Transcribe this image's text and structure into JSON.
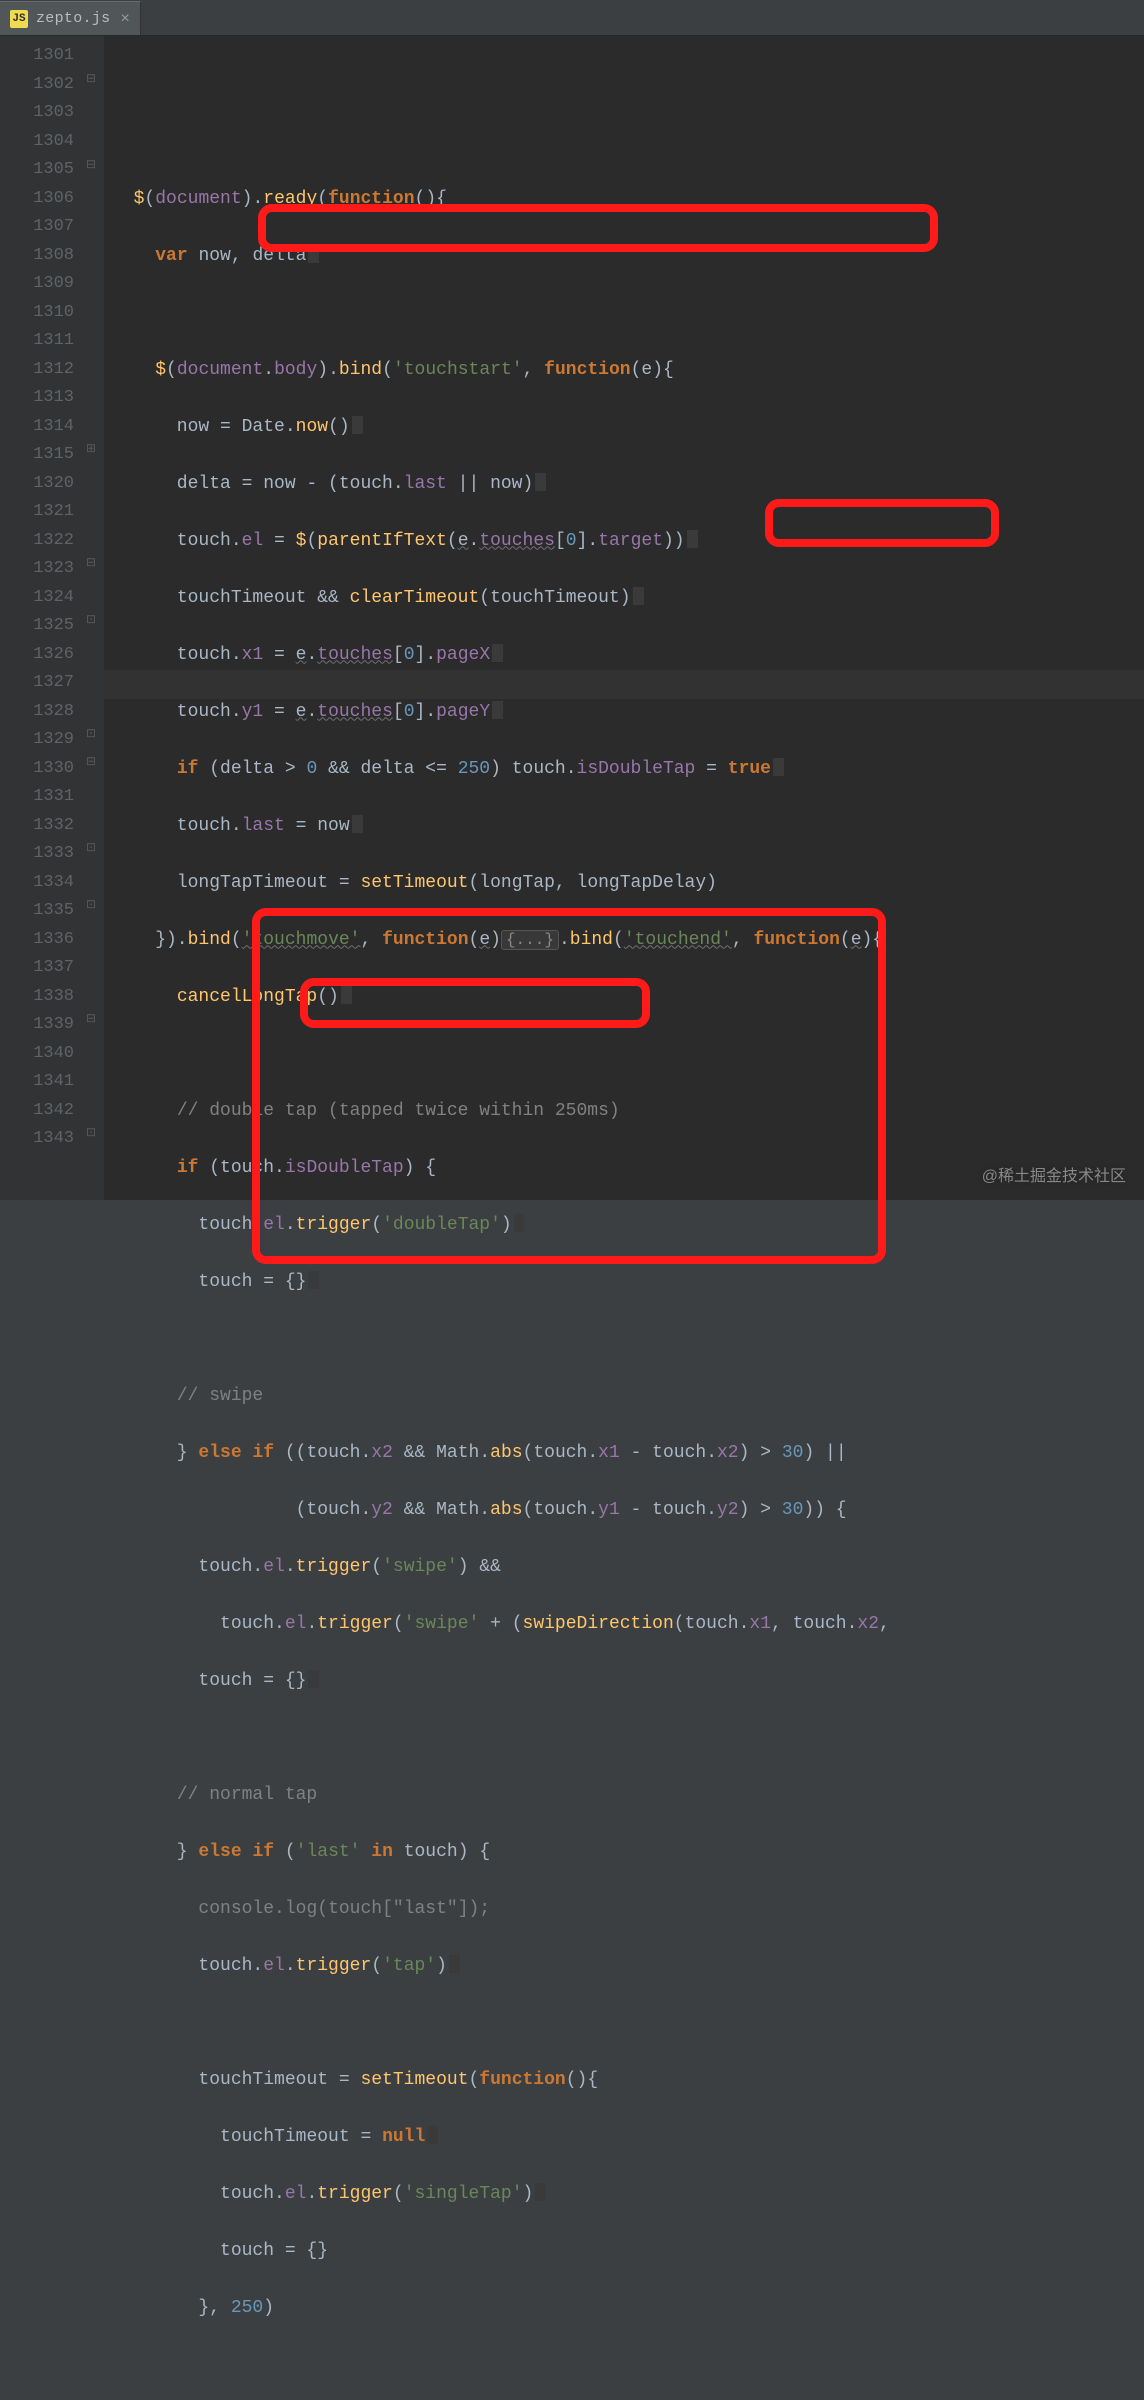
{
  "tab": {
    "filename": "zepto.js",
    "badge": "JS"
  },
  "line_numbers": [
    1301,
    1302,
    1303,
    1304,
    1305,
    1306,
    1307,
    1308,
    1309,
    1310,
    1311,
    1312,
    1313,
    1314,
    1315,
    1320,
    1321,
    1322,
    1323,
    1324,
    1325,
    1326,
    1327,
    1328,
    1329,
    1330,
    1331,
    1332,
    1333,
    1334,
    1335,
    1336,
    1337,
    1338,
    1339,
    1340,
    1341,
    1342,
    1343
  ],
  "watermark": "@稀土掘金技术社区",
  "strings": {
    "touchstart": "'touchstart'",
    "touchmove": "'touchmove'",
    "touchend": "'touchend'",
    "doubleTap": "'doubleTap'",
    "swipe": "'swipe'",
    "swipe2": "'swipe'",
    "last": "'last'",
    "lastIdx": "\"last\"",
    "tap": "'tap'",
    "singleTap": "'singleTap'"
  },
  "nums": {
    "zero": "0",
    "n250": "250",
    "n30": "30",
    "n30b": "30"
  },
  "idents": {
    "document": "document",
    "ready": "ready",
    "function": "function",
    "var": "var",
    "now": "now",
    "delta": "delta",
    "body": "body",
    "bind": "bind",
    "e": "e",
    "Date": "Date",
    "nowFn": "now",
    "touch": "touch",
    "last": "last",
    "el": "el",
    "$": "$",
    "parentIfText": "parentIfText",
    "touches": "touches",
    "target": "target",
    "touchTimeout": "touchTimeout",
    "clearTimeout": "clearTimeout",
    "x1": "x1",
    "pageX": "pageX",
    "y1": "y1",
    "pageY": "pageY",
    "if": "if",
    "isDoubleTap": "isDoubleTap",
    "true": "true",
    "longTapTimeout": "longTapTimeout",
    "setTimeout": "setTimeout",
    "longTap": "longTap",
    "longTapDelay": "longTapDelay",
    "cancelLongTap": "cancelLongTap",
    "trigger": "trigger",
    "else": "else",
    "x2": "x2",
    "Math": "Math",
    "abs": "abs",
    "y2": "y2",
    "swipeDirection": "swipeDirection",
    "in": "in",
    "console": "console",
    "log": "log",
    "null": "null"
  },
  "comments": {
    "doubletap": "// double tap (tapped twice within 250ms)",
    "swipe": "// swipe",
    "normaltap": "// normal tap"
  }
}
